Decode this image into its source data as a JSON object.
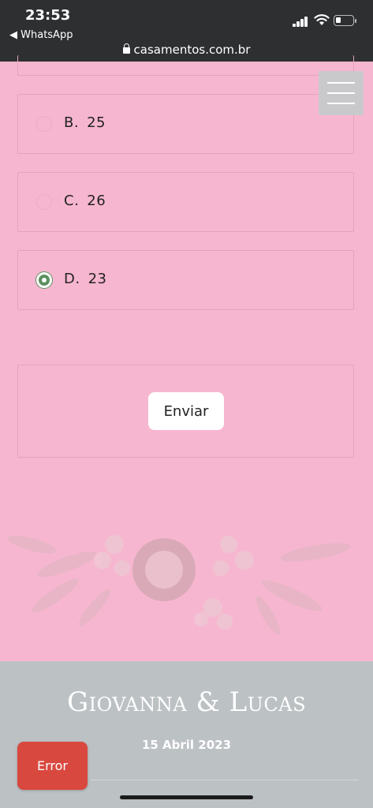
{
  "status_bar": {
    "time": "23:53",
    "back_app": "◀ WhatsApp",
    "url": "casamentos.com.br"
  },
  "quiz": {
    "options": [
      {
        "letter": "B.",
        "value": "25",
        "selected": false
      },
      {
        "letter": "C.",
        "value": "26",
        "selected": false
      },
      {
        "letter": "D.",
        "value": "23",
        "selected": true
      }
    ],
    "submit_label": "Enviar"
  },
  "footer": {
    "names": "Giovanna & Lucas",
    "date": "15 Abril 2023"
  },
  "error_label": "Error",
  "colors": {
    "background": "#f7b6cf",
    "selected_radio": "#5b8f5e",
    "footer": "#bcc1c4",
    "error": "#d9483f"
  }
}
